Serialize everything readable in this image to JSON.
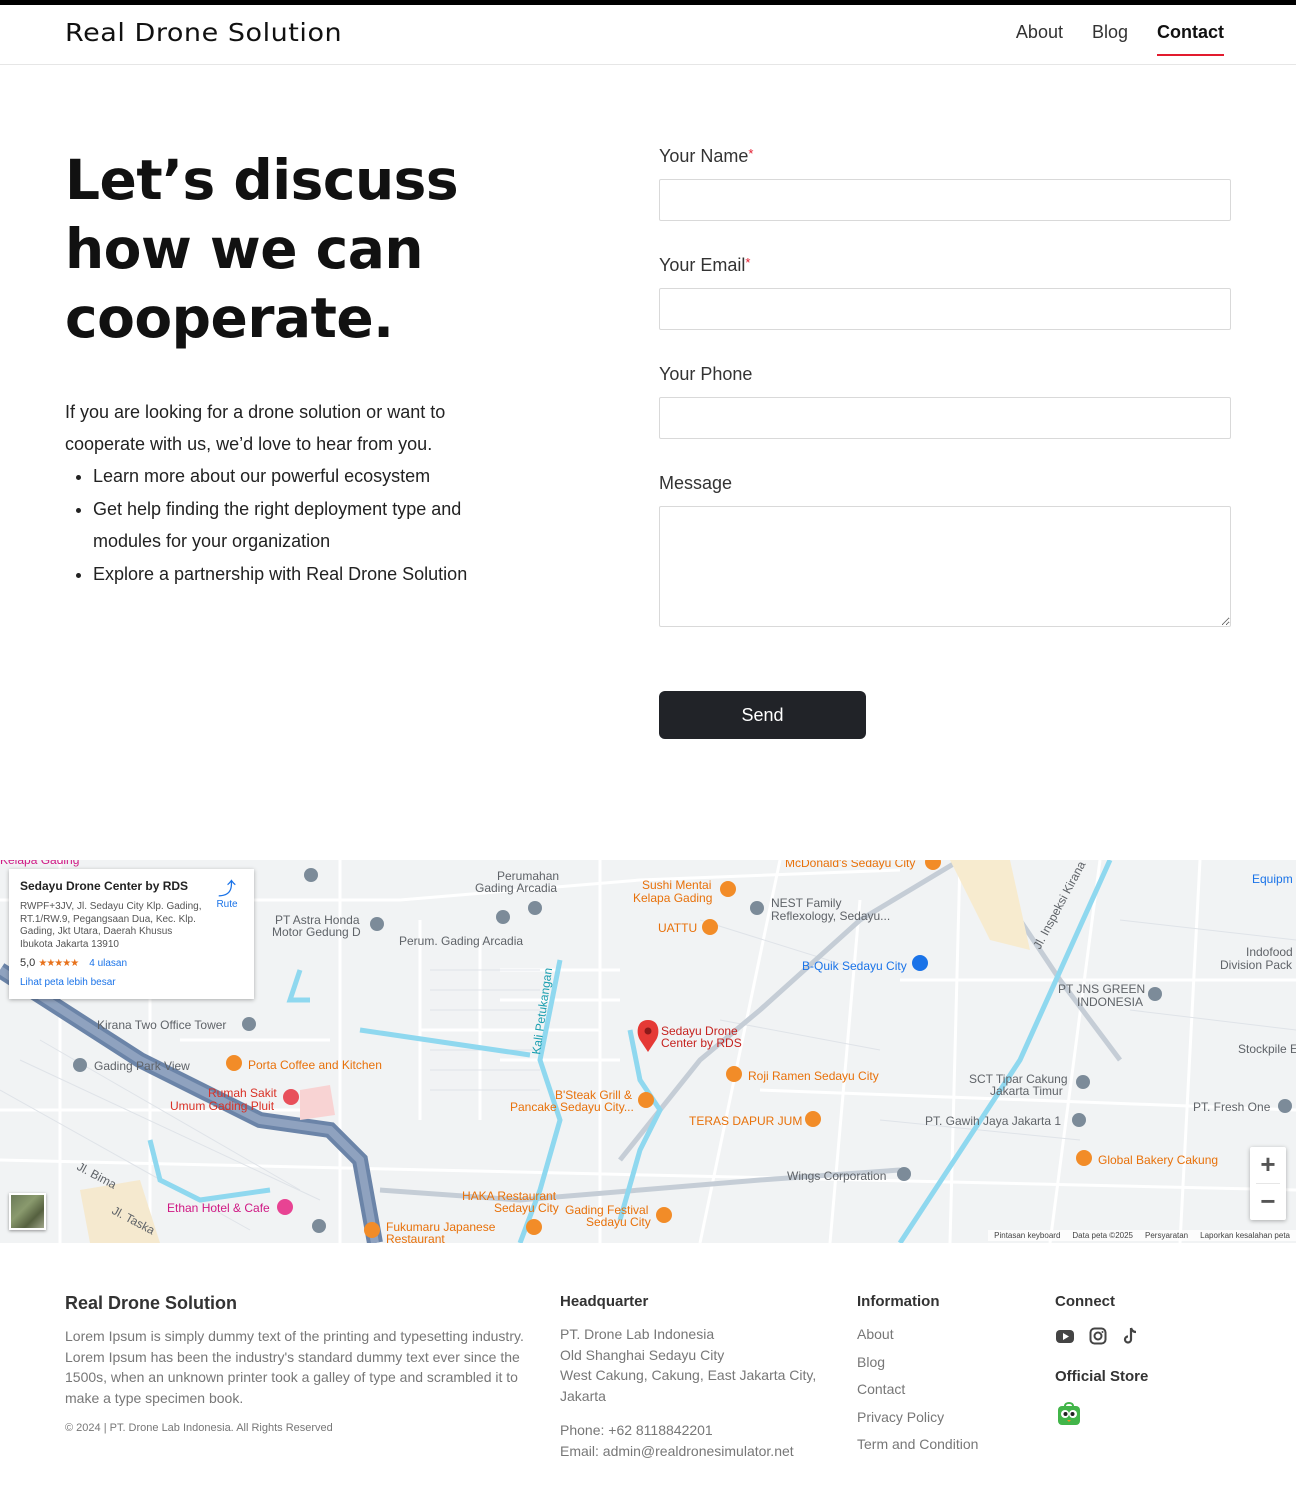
{
  "header": {
    "logo": "Real Drone Solution",
    "nav": [
      {
        "label": "About"
      },
      {
        "label": "Blog"
      },
      {
        "label": "Contact"
      }
    ]
  },
  "hero": {
    "title": "Let’s discuss how we can cooperate.",
    "intro": "If you are looking for a drone solution or want to cooperate with us, we’d love to hear from you.",
    "bullets": [
      "Learn more about our powerful ecosystem",
      "Get help finding the right deployment type and modules for your organization",
      "Explore a partnership with Real Drone Solution"
    ]
  },
  "form": {
    "name_label": "Your Name",
    "email_label": "Your Email",
    "phone_label": "Your Phone",
    "message_label": "Message",
    "required_mark": "*",
    "send_label": "Send"
  },
  "map": {
    "card": {
      "name": "Sedayu Drone Center by RDS",
      "address": "RWPF+3JV, Jl. Sedayu City Klp. Gading, RT.1/RW.9, Pegangsaan Dua, Kec. Klp. Gading, Jkt Utara, Daerah Khusus Ibukota Jakarta 13910",
      "rating": "5,0",
      "stars": "★★★★★",
      "reviews": "4 ulasan",
      "bigger_map": "Lihat peta lebih besar",
      "route": "Rute"
    },
    "marker_label_1": "Sedayu Drone",
    "marker_label_2": "Center by RDS",
    "labels": [
      "Perumahan Gading Arcadia",
      "PT Astra Honda Motor Gedung D",
      "Perum. Gading Arcadia",
      "Kirana Two Office Tower",
      "Gading Park View",
      "Porta Coffee and Kitchen",
      "Rumah Sakit Umum Gading Pluit",
      "Ethan Hotel & Cafe",
      "Sushi Mentai Kelapa Gading",
      "UATTU",
      "NEST Family Reflexology, Sedayu...",
      "McDonald's Sedayu City",
      "B-Quik Sedayu City",
      "Roji Ramen Sedayu City",
      "B'Steak Grill & Pancake Sedayu City...",
      "TERAS DAPUR JUM",
      "HAKA Restaurant Sedayu City",
      "Gading Festival Sedayu City",
      "Fukumaru Japanese Restaurant",
      "Wings Corporation",
      "PT JNS GREEN INDONESIA",
      "SCT Tipar Cakung Jakarta Timur",
      "PT. Gawih Jaya Jakarta 1",
      "Global Bakery Cakung",
      "PT. Fresh One",
      "Stockpile E",
      "Indofood Division Pack",
      "Equipm",
      "Jl. Inspeksi Kirana",
      "Kali Petukangan",
      "Jl. Bima",
      "Jl. Taska",
      "Kelapa Gading"
    ],
    "zoom_in": "+",
    "zoom_out": "−",
    "footer_links": [
      "Pintasan keyboard",
      "Data peta ©2025",
      "Persyaratan",
      "Laporkan kesalahan peta"
    ]
  },
  "footer": {
    "brand": "Real Drone Solution",
    "description": "Lorem Ipsum is simply dummy text of the printing and typesetting industry. Lorem Ipsum has been the industry's standard dummy text ever since the 1500s, when an unknown printer took a galley of type and scrambled it to make a type specimen book.",
    "copyright": "© 2024 | PT. Drone Lab Indonesia. All Rights Reserved",
    "hq_title": "Headquarter",
    "hq_lines": [
      "PT. Drone Lab Indonesia",
      "Old Shanghai Sedayu City",
      "West Cakung, Cakung, East Jakarta City,",
      "Jakarta"
    ],
    "phone": "Phone: +62 8118842201",
    "email": "Email: admin@realdronesimulator.net",
    "info_title": "Information",
    "info_links": [
      "About",
      "Blog",
      "Contact",
      "Privacy Policy",
      "Term and Condition"
    ],
    "connect_title": "Connect",
    "store_title": "Official Store"
  },
  "colors": {
    "accent": "#e21b2e",
    "button": "#212328",
    "map_water": "#8fd8ef",
    "map_highway": "#6b84a8",
    "poi_orange": "#f28c28"
  }
}
